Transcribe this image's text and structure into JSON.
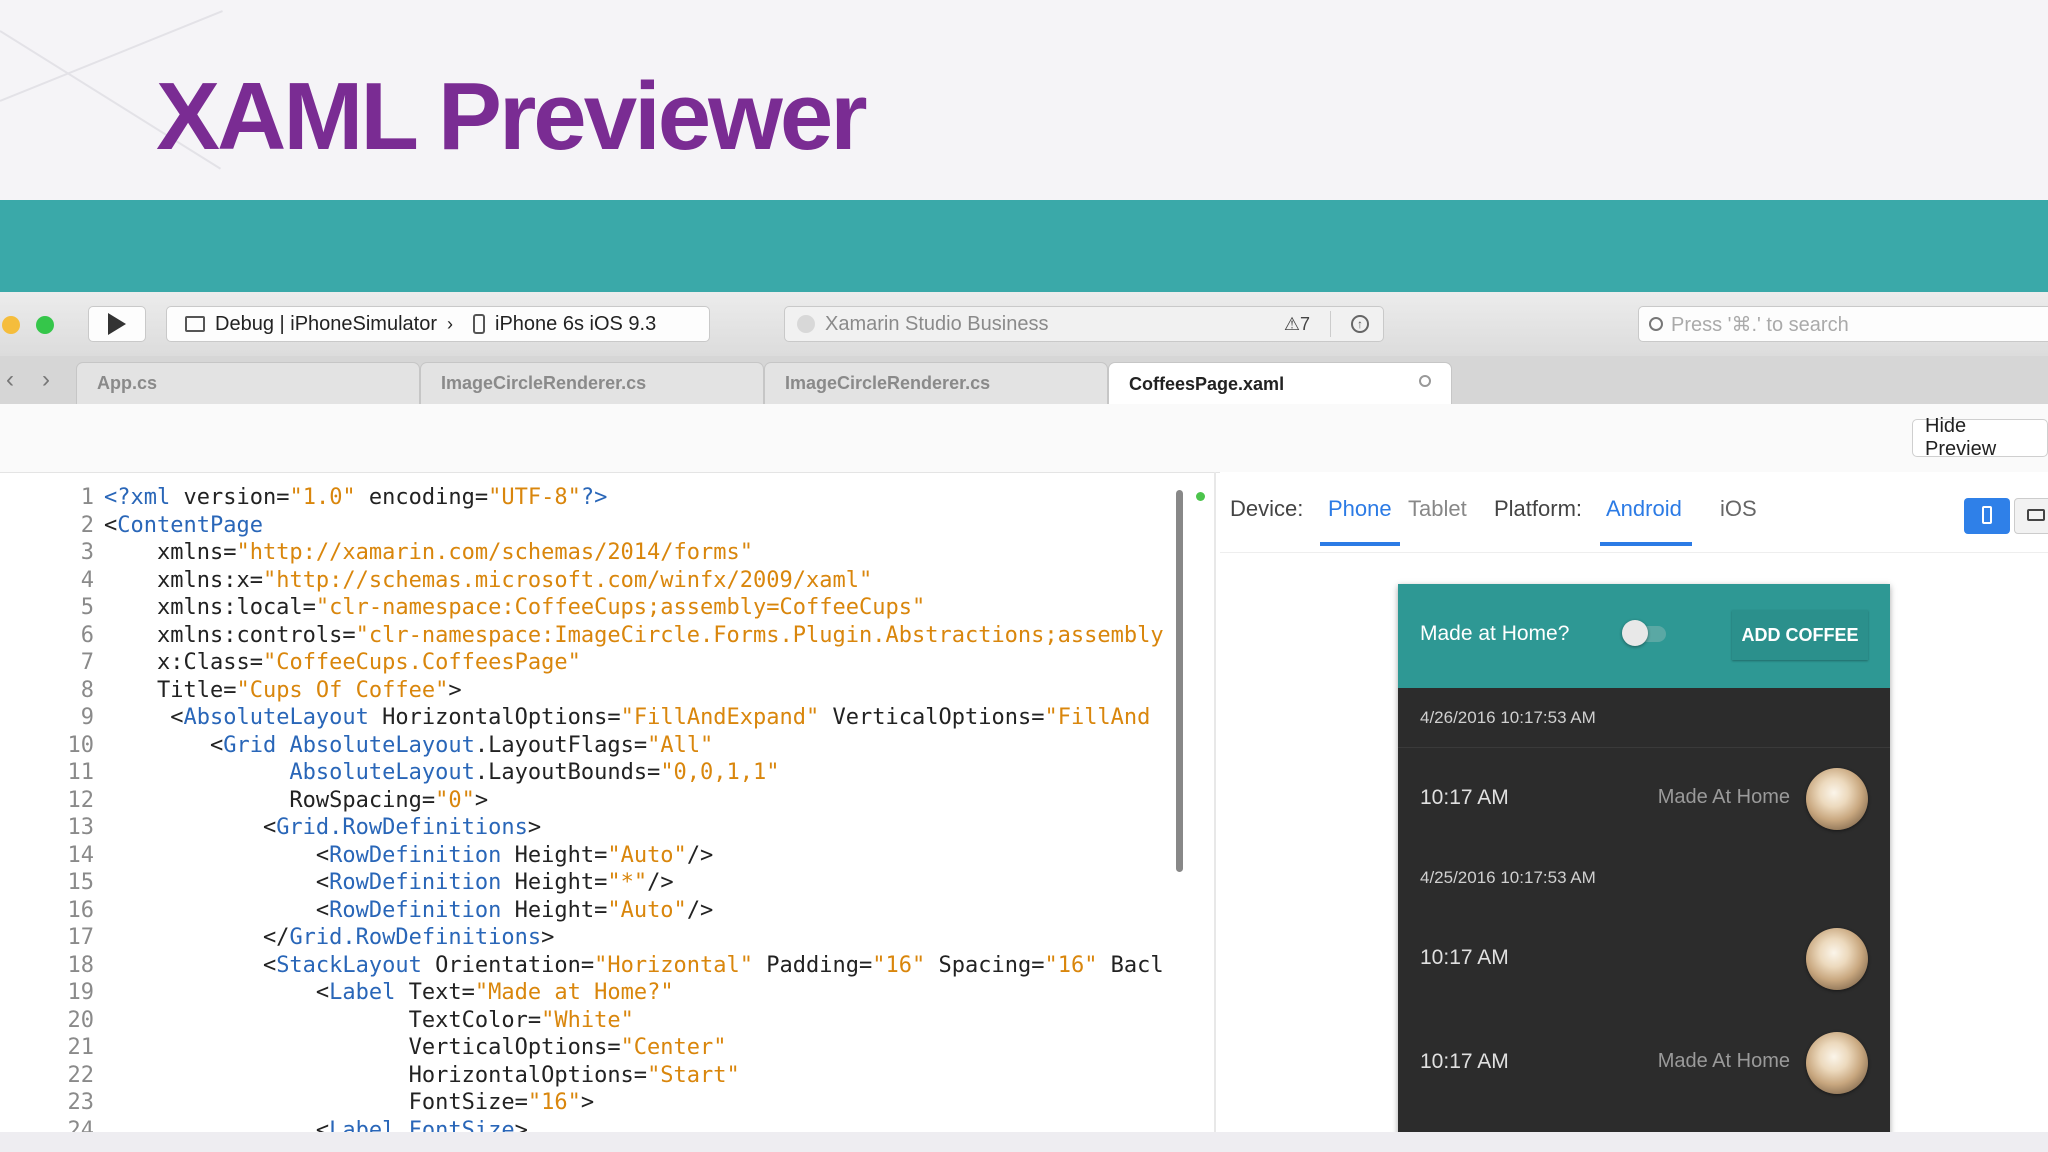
{
  "slide": {
    "title": "XAML Previewer"
  },
  "toolbar": {
    "config": "Debug | iPhoneSimulator",
    "device": "iPhone 6s iOS 9.3",
    "status": "Xamarin Studio Business",
    "warnings": "⚠7",
    "search_placeholder": "Press '⌘.' to search"
  },
  "tabs": [
    {
      "label": "App.cs"
    },
    {
      "label": "ImageCircleRenderer.cs"
    },
    {
      "label": "ImageCircleRenderer.cs"
    },
    {
      "label": "CoffeesPage.xaml"
    }
  ],
  "subbar": {
    "hide_preview": "Hide Preview"
  },
  "code": {
    "lines": [
      {
        "n": "1",
        "tokens": [
          {
            "t": "t",
            "v": "<?xml "
          },
          {
            "t": "p",
            "v": "version="
          },
          {
            "t": "s",
            "v": "\"1.0\""
          },
          {
            "t": "p",
            "v": " encoding="
          },
          {
            "t": "s",
            "v": "\"UTF-8\""
          },
          {
            "t": "t",
            "v": "?>"
          }
        ]
      },
      {
        "n": "2",
        "tokens": [
          {
            "t": "p",
            "v": "<"
          },
          {
            "t": "t",
            "v": "ContentPage"
          }
        ]
      },
      {
        "n": "3",
        "tokens": [
          {
            "t": "p",
            "v": "    xmlns="
          },
          {
            "t": "s",
            "v": "\"http://xamarin.com/schemas/2014/forms\""
          }
        ]
      },
      {
        "n": "4",
        "tokens": [
          {
            "t": "p",
            "v": "    xmlns:x="
          },
          {
            "t": "s",
            "v": "\"http://schemas.microsoft.com/winfx/2009/xaml\""
          }
        ]
      },
      {
        "n": "5",
        "tokens": [
          {
            "t": "p",
            "v": "    xmlns:local="
          },
          {
            "t": "s",
            "v": "\"clr-namespace:CoffeeCups;assembly=CoffeeCups\""
          }
        ]
      },
      {
        "n": "6",
        "tokens": [
          {
            "t": "p",
            "v": "    xmlns:controls="
          },
          {
            "t": "s",
            "v": "\"clr-namespace:ImageCircle.Forms.Plugin.Abstractions;assembly"
          }
        ]
      },
      {
        "n": "7",
        "tokens": [
          {
            "t": "p",
            "v": "    x:Class="
          },
          {
            "t": "s",
            "v": "\"CoffeeCups.CoffeesPage\""
          }
        ]
      },
      {
        "n": "8",
        "tokens": [
          {
            "t": "p",
            "v": "    Title="
          },
          {
            "t": "s",
            "v": "\"Cups Of Coffee\""
          },
          {
            "t": "p",
            "v": ">"
          }
        ]
      },
      {
        "n": "9",
        "tokens": [
          {
            "t": "p",
            "v": "     <"
          },
          {
            "t": "t",
            "v": "AbsoluteLayout"
          },
          {
            "t": "p",
            "v": " HorizontalOptions="
          },
          {
            "t": "s",
            "v": "\"FillAndExpand\""
          },
          {
            "t": "p",
            "v": " VerticalOptions="
          },
          {
            "t": "s",
            "v": "\"FillAnd"
          }
        ]
      },
      {
        "n": "10",
        "tokens": [
          {
            "t": "p",
            "v": "        <"
          },
          {
            "t": "t",
            "v": "Grid AbsoluteLayout"
          },
          {
            "t": "p",
            "v": ".LayoutFlags="
          },
          {
            "t": "s",
            "v": "\"All\""
          }
        ]
      },
      {
        "n": "11",
        "tokens": [
          {
            "t": "t",
            "v": "              AbsoluteLayout"
          },
          {
            "t": "p",
            "v": ".LayoutBounds="
          },
          {
            "t": "s",
            "v": "\"0,0,1,1\""
          }
        ]
      },
      {
        "n": "12",
        "tokens": [
          {
            "t": "p",
            "v": "              RowSpacing="
          },
          {
            "t": "s",
            "v": "\"0\""
          },
          {
            "t": "p",
            "v": ">"
          }
        ]
      },
      {
        "n": "13",
        "tokens": [
          {
            "t": "p",
            "v": "            <"
          },
          {
            "t": "t",
            "v": "Grid.RowDefinitions"
          },
          {
            "t": "p",
            "v": ">"
          }
        ]
      },
      {
        "n": "14",
        "tokens": [
          {
            "t": "p",
            "v": "                <"
          },
          {
            "t": "t",
            "v": "RowDefinition"
          },
          {
            "t": "p",
            "v": " Height="
          },
          {
            "t": "s",
            "v": "\"Auto\""
          },
          {
            "t": "p",
            "v": "/>"
          }
        ]
      },
      {
        "n": "15",
        "tokens": [
          {
            "t": "p",
            "v": "                <"
          },
          {
            "t": "t",
            "v": "RowDefinition"
          },
          {
            "t": "p",
            "v": " Height="
          },
          {
            "t": "s",
            "v": "\"*\""
          },
          {
            "t": "p",
            "v": "/>"
          }
        ]
      },
      {
        "n": "16",
        "tokens": [
          {
            "t": "p",
            "v": "                <"
          },
          {
            "t": "t",
            "v": "RowDefinition"
          },
          {
            "t": "p",
            "v": " Height="
          },
          {
            "t": "s",
            "v": "\"Auto\""
          },
          {
            "t": "p",
            "v": "/>"
          }
        ]
      },
      {
        "n": "17",
        "tokens": [
          {
            "t": "p",
            "v": "            </"
          },
          {
            "t": "t",
            "v": "Grid.RowDefinitions"
          },
          {
            "t": "p",
            "v": ">"
          }
        ]
      },
      {
        "n": "18",
        "tokens": [
          {
            "t": "p",
            "v": "            <"
          },
          {
            "t": "t",
            "v": "StackLayout"
          },
          {
            "t": "p",
            "v": " Orientation="
          },
          {
            "t": "s",
            "v": "\"Horizontal\""
          },
          {
            "t": "p",
            "v": " Padding="
          },
          {
            "t": "s",
            "v": "\"16\""
          },
          {
            "t": "p",
            "v": " Spacing="
          },
          {
            "t": "s",
            "v": "\"16\""
          },
          {
            "t": "p",
            "v": " Bacl"
          }
        ]
      },
      {
        "n": "19",
        "tokens": [
          {
            "t": "p",
            "v": "                <"
          },
          {
            "t": "t",
            "v": "Label"
          },
          {
            "t": "p",
            "v": " Text="
          },
          {
            "t": "s",
            "v": "\"Made at Home?\""
          }
        ]
      },
      {
        "n": "20",
        "tokens": [
          {
            "t": "p",
            "v": "                       TextColor="
          },
          {
            "t": "s",
            "v": "\"White\""
          }
        ]
      },
      {
        "n": "21",
        "tokens": [
          {
            "t": "p",
            "v": "                       VerticalOptions="
          },
          {
            "t": "s",
            "v": "\"Center\""
          }
        ]
      },
      {
        "n": "22",
        "tokens": [
          {
            "t": "p",
            "v": "                       HorizontalOptions="
          },
          {
            "t": "s",
            "v": "\"Start\""
          }
        ]
      },
      {
        "n": "23",
        "tokens": [
          {
            "t": "p",
            "v": "                       FontSize="
          },
          {
            "t": "s",
            "v": "\"16\""
          },
          {
            "t": "p",
            "v": ">"
          }
        ]
      },
      {
        "n": "24",
        "tokens": [
          {
            "t": "p",
            "v": "                <"
          },
          {
            "t": "t",
            "v": "Label FontSize"
          },
          {
            "t": "p",
            "v": ">"
          }
        ]
      }
    ]
  },
  "preview": {
    "device_label": "Device:",
    "phone": "Phone",
    "tablet": "Tablet",
    "platform_label": "Platform:",
    "android": "Android",
    "ios": "iOS"
  },
  "app": {
    "toggle_label": "Made at Home?",
    "add_button": "ADD COFFEE",
    "header1": "4/26/2016 10:17:53 AM",
    "row1_time": "10:17 AM",
    "row1_made": "Made At Home",
    "header2": "4/25/2016 10:17:53 AM",
    "row2_time": "10:17 AM",
    "row3_time": "10:17 AM",
    "row3_made": "Made At Home"
  },
  "colors": {
    "title": "#7a2c93",
    "band": "#3aa9a9",
    "appbar": "#2e9894",
    "selected_tab": "#2c7be5",
    "tag": "#2966b8",
    "string": "#d9860c"
  }
}
